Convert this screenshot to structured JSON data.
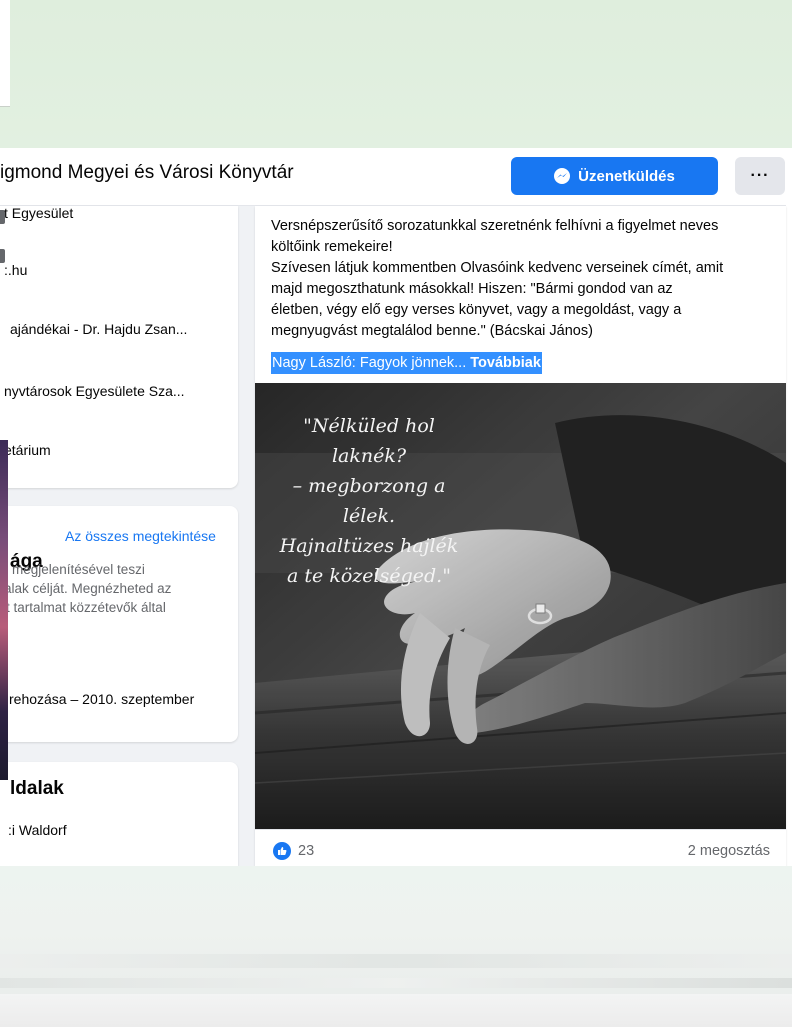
{
  "header": {
    "page_title": "igmond Megyei és Városi Könyvtár",
    "message_button": "Üzenetküldés",
    "more_button": "···"
  },
  "sidebar": {
    "info_items": [
      {
        "label": "t Egyesület"
      },
      {
        "label": ":.hu"
      },
      {
        "label": "ajándékai - Dr. Hajdu Zsan..."
      },
      {
        "label": "nyvtárosok Egyesülete Sza..."
      },
      {
        "label": "etárium"
      }
    ],
    "see_all": "Az összes megtekintése",
    "about_heading": "ága",
    "about_lines": [
      "megjelenítésével teszi",
      "alak célját. Megnézheted az",
      "t tartalmat közzétevők által"
    ],
    "founded": "rehozása – 2010. szeptember",
    "pages_heading": "ldalak",
    "pages_first": ":i Waldorf"
  },
  "post": {
    "lines": [
      "Versnépszerűsítő sorozatunkkal szeretnénk felhívni a figyelmet neves",
      "költőink remekeire!",
      "Szívesen látjuk kommentben Olvasóink kedvenc verseinek címét, amit",
      "majd megoszthatunk másokkal! Hiszen: \"Bármi gondod van az",
      "életben, végy elő egy verses könyvet, vagy a megoldást, vagy a",
      "megnyugvást megtalálod benne.\" (Bácskai János)"
    ],
    "link_text": "Nagy László: Fagyok jönnek...",
    "see_more": "Továbbiak",
    "poem_lines": [
      "\"Nélküled hol laknék?",
      "– megborzong a lélek.",
      "Hajnaltüzes hajlék",
      "a te közelséged.\""
    ],
    "like_count": "23",
    "shares": "2 megosztás"
  },
  "colors": {
    "accent": "#1877f2",
    "top_band": "#e0efdf",
    "page_bg": "#f0f2f5",
    "highlight": "#3390ff"
  },
  "icons": [
    "messenger-icon",
    "more-icon",
    "like-icon"
  ]
}
